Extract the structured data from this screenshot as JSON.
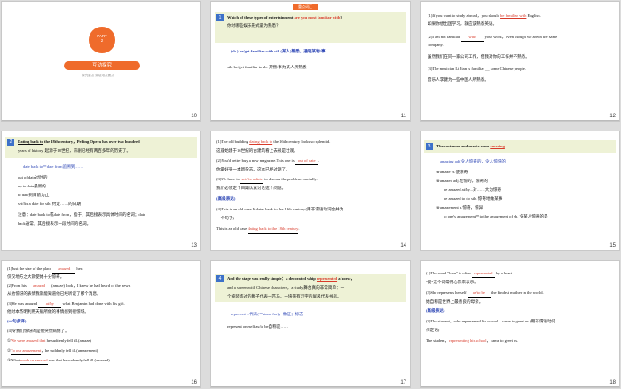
{
  "slides": [
    {
      "num": "10",
      "part": "PART",
      "part_no": "2",
      "title": "互动探究",
      "sub": "探究重点  突破难点要点"
    },
    {
      "num": "11",
      "tag": "重点词汇",
      "l1a": "Which of these types of entertainment ",
      "l1b": "are you most familiar with",
      "l1c": "?",
      "l2": "你对哪些娱乐形式最为熟悉？",
      "l3": "(sb.) be/get familiar with sth.(某人)熟悉，通晓某物/事",
      "l4": "sth. be/get familiar to sb. 某物/事为某人所熟悉"
    },
    {
      "num": "12",
      "l1a": "(1)If you want to study abroad，you should ",
      "l1b": "be familiar with",
      "l1c": " English.",
      "l2": "如果你想出国学习，就应该熟悉英语。",
      "l3a": "(2)I am not familiar ",
      "l3b": "with",
      "l3c": " your work，even though we are in the same",
      "l4": "company.",
      "l5": "虽然我们在同一家公司工作，但我对你的工作并不熟悉。",
      "l6": "(3)The musician Li Jian is familiar __ some Chinese people.",
      "l7": "音乐人李健为一些中国人所熟悉。"
    },
    {
      "num": "13",
      "l1a": "Dating back to",
      "l1b": " the 18th century，Peking Opera has over two hundred",
      "l2": "years of history. 起源于18世纪，京剧已经有两百多年的历史了。",
      "l3": "date back to＝date from追溯到……",
      "l4": "out of date过时的",
      "l5": "up to date最新的",
      "l6": "to date到目前为止",
      "l7": "set/fix a date for sth. 约定……的日期",
      "l8": "注意：date back to或date from，指于，其后接表示具体时间的名词；date",
      "l9": "back通常，其后接表示一段时间的名词。"
    },
    {
      "num": "14",
      "l1a": "(1)The old building ",
      "l1b": "dating back to",
      "l1c": " the 16th century looks so splendid.",
      "l2": "这座始建于16世纪的古建筑看上去很是壮观。",
      "l3a": "(2)You'd better buy a new magazine.This one is ",
      "l3b": "out of date",
      "l3c": ".",
      "l4": "你最好买一本新杂志。这本已经过期了。",
      "l5a": "(3)We have to ",
      "l5b": "set/fix a date",
      "l5c": " to discuss the problem carefully.",
      "l6": "我们必须定个日期认真讨论这个问题。",
      "l7": "(高级表达)",
      "l8": "(4)This is an old vase.It dates back to the 18th century.(用非谓语动词合并为",
      "l9": "一个句子)",
      "l10a": "This is an old vase ",
      "l10b": "dating back to the 18th century",
      "l10c": "."
    },
    {
      "num": "15",
      "l1a": "The costumes and masks were ",
      "l1b": "amazing",
      "l1c": ".",
      "l2": "amazing adj.令人惊奇的，令人惊讶的",
      "l3": "※amaze vt.使惊奇",
      "l4": "※amazed adj.吃惊的，惊奇的",
      "l5": "be amazed at/by...对……大为惊奇",
      "l6": "be amazed to do sth. 惊奇地做某事",
      "l7": "※amazement n.惊奇，惊异",
      "l8": "to one's amazement＝to the amazement of sb. 令某人惊奇的是"
    },
    {
      "num": "16",
      "l1a": "(1)Just the size of the place ",
      "l1b": "amazed",
      "l1c": " her.",
      "l2": "仅仅地方之大就使她十分惊奇。",
      "l3a": "(2)From his ",
      "l3b": "amazed",
      "l3c": " (amaze) look，I knew he had heard of the news.",
      "l4": "从他惊讶的表情我就能知道他已经听说了那个消息。",
      "l5a": "(3)He was amazed ",
      "l5b": "at/by",
      "l5c": " what Benjamin had done with his gift.",
      "l6": "他对本杰明利用天赋所做的事情感到很惊讶。",
      "l7": "(一句多译)",
      "l8": "(4)令我们惊讶的是他突然病倒了。",
      "l9a": "①",
      "l9b": "We were amazed that",
      "l9c": " he suddenly fell ill.(amaze)",
      "l10a": "②",
      "l10b": "To our amazement",
      "l10c": "，he suddenly fell ill.(amazement)",
      "l11a": "③What ",
      "l11b": "made us amazed",
      "l11c": " was that he suddenly fell ill.(amazed)"
    },
    {
      "num": "17",
      "l1a": "And the stage was really simple：a decorated whip ",
      "l1b": "represented",
      "l1c": " a horse，",
      "l2": "and a screen with Chinese characters，a study.舞台真的非常简单：一",
      "l3": "个被装饰过的鞭子代表一匹马，一块带有汉字的屏风代表书房。",
      "l4": "represent v.代表(＝stand for)，象征；标志",
      "l5": "represent oneself as/to be自称是……"
    },
    {
      "num": "18",
      "l1a": "(1)The word \"love\" is often ",
      "l1b": "represented",
      "l1c": " by a heart.",
      "l2": "\"爱\"这个词常用心形来表示。",
      "l3a": "(2)She represents herself ",
      "l3b": "as/to be",
      "l3c": " the kindest mother in the world.",
      "l4": "她自称是世界上最善良的母亲。",
      "l5": "(高级表达)",
      "l6": "(3)The student，who represented his school，came to greet us.(用非谓语动词",
      "l7": "作定语)",
      "l8a": "The student，",
      "l8b": "representing his school",
      "l8c": "，came to greet us."
    }
  ]
}
